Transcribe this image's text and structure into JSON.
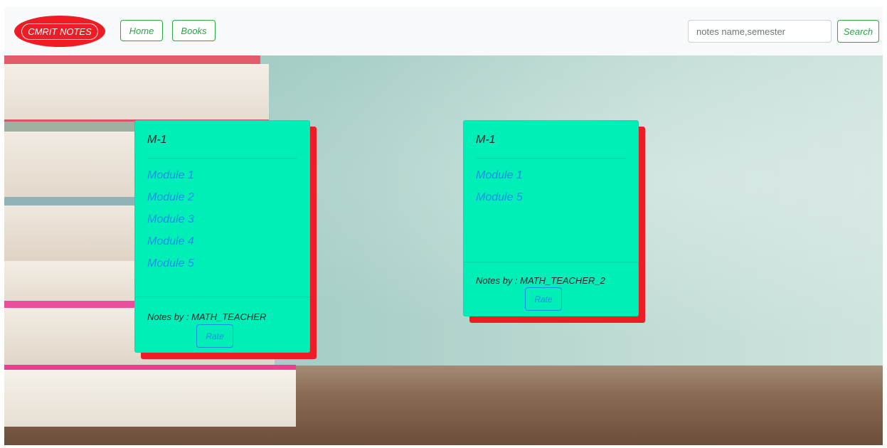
{
  "navbar": {
    "brand": "CMRIT NOTES",
    "links": [
      "Home",
      "Books"
    ],
    "search": {
      "placeholder": "notes name,semester",
      "value": ""
    },
    "search_button": "Search"
  },
  "cards": [
    {
      "title": "M-1",
      "modules": [
        "Module 1",
        "Module 2",
        "Module 3",
        "Module 4",
        "Module 5"
      ],
      "notes_by": "Notes by : MATH_TEACHER",
      "rate_label": "Rate"
    },
    {
      "title": "M-1",
      "modules": [
        "Module 1",
        "Module 5"
      ],
      "notes_by": "Notes by : MATH_TEACHER_2",
      "rate_label": "Rate"
    }
  ],
  "colors": {
    "card_bg": "#00eeb8",
    "card_shadow": "#ee1c25",
    "brand_bg": "#ee1c25",
    "nav_button": "#28a745",
    "link": "#1f8fe6"
  }
}
